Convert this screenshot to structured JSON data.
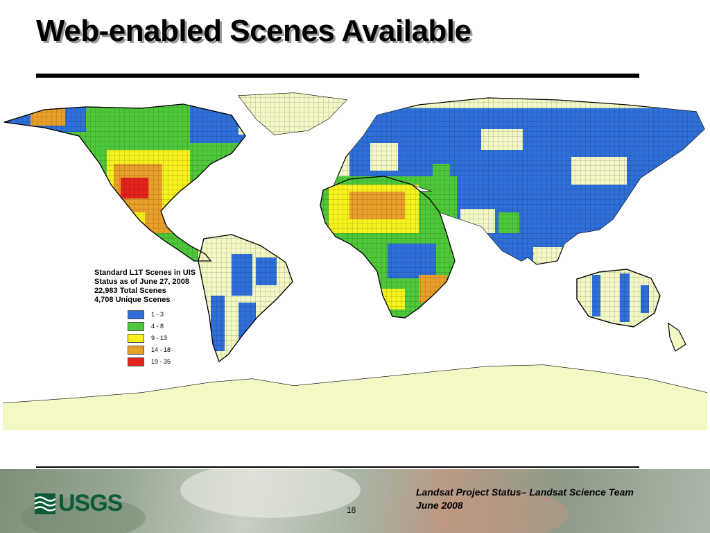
{
  "slide": {
    "title": "Web-enabled Scenes Available",
    "page_number": "18",
    "footer_line1": "Landsat Project Status– Landsat Science Team",
    "footer_line2": "June 2008",
    "logo_text": "USGS"
  },
  "map": {
    "ocean_color": "#ffffff",
    "land_color": "#f3f8c4",
    "legend": {
      "lines": [
        "Standard L1T Scenes in UIS",
        "Status as of June 27, 2008",
        "22,983 Total Scenes",
        "4,708 Unique Scenes"
      ],
      "items": [
        {
          "label": "1 - 3",
          "color": "#2f6fd8"
        },
        {
          "label": "4 - 8",
          "color": "#4ec83a"
        },
        {
          "label": "9 - 13",
          "color": "#f7f21d"
        },
        {
          "label": "14 - 18",
          "color": "#e9a02a"
        },
        {
          "label": "19 - 35",
          "color": "#e4231c"
        }
      ]
    }
  }
}
